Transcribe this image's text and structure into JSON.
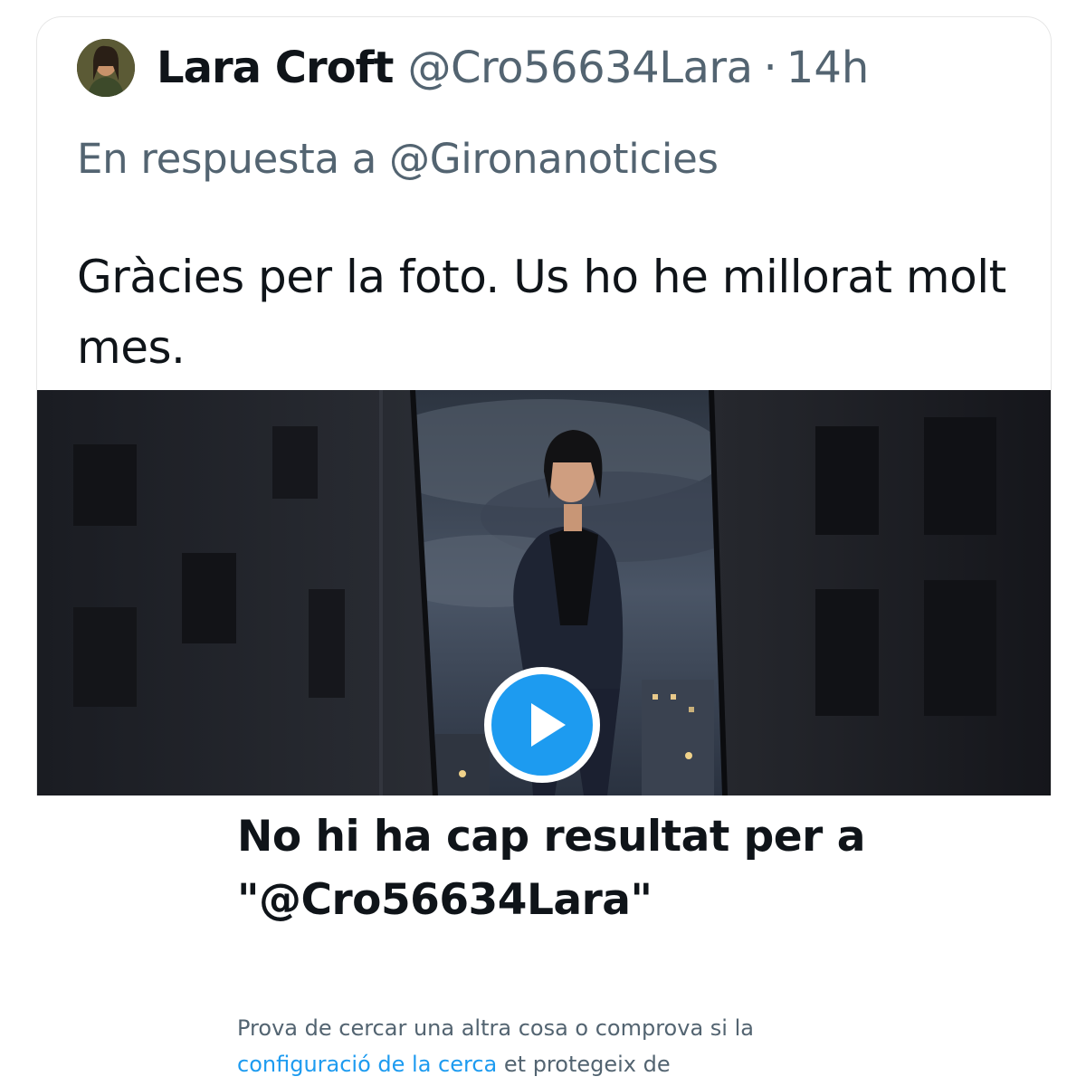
{
  "tweet": {
    "author_name": "Lara Croft",
    "author_handle": "@Cro56634Lara",
    "separator": "·",
    "time_ago": "14h",
    "reply_prefix": "En respuesta a",
    "reply_to": "@Gironanoticies",
    "text": "Gràcies per la foto. Us ho he millorat molt mes.",
    "media": {
      "type": "video",
      "play_icon": "play-icon",
      "description_icon": "video-thumbnail"
    }
  },
  "search_results": {
    "title": "No hi ha cap resultat per a \"@Cro56634Lara\"",
    "suggestion_prefix": "Prova de cercar una altra cosa o comprova si la",
    "suggestion_link": "configuració de la cerca",
    "suggestion_suffix": "et protegeix de"
  },
  "colors": {
    "accent": "#1d9bf0",
    "text_primary": "#0f1419",
    "text_secondary": "#536471"
  }
}
